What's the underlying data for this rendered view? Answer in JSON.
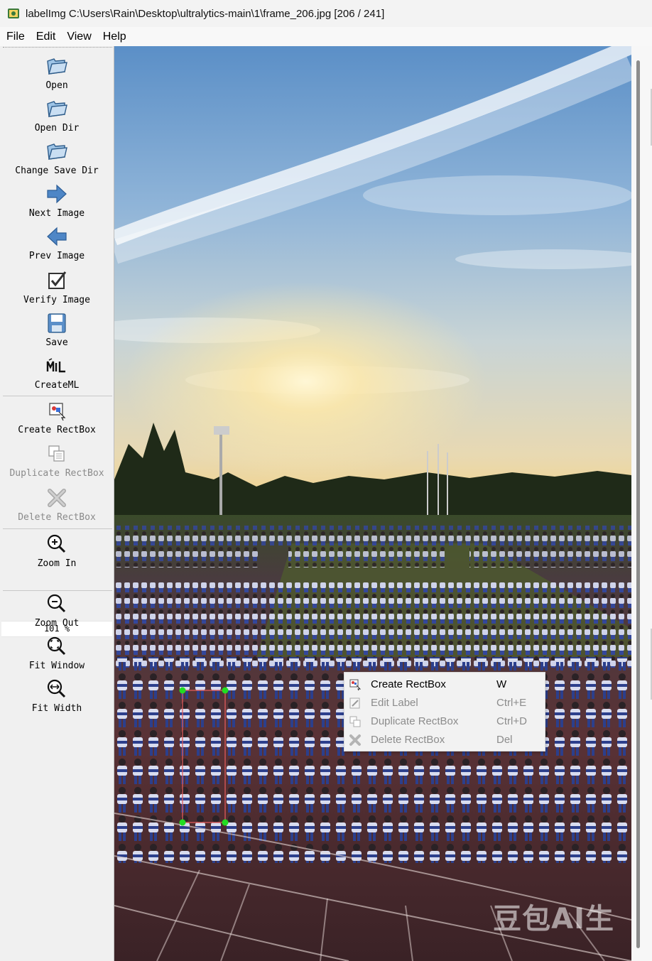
{
  "window": {
    "title": "labelImg C:\\Users\\Rain\\Desktop\\ultralytics-main\\1\\frame_206.jpg [206 / 241]",
    "app_icon": "labelimg-app-icon"
  },
  "menubar": {
    "items": [
      {
        "label": "File"
      },
      {
        "label": "Edit"
      },
      {
        "label": "View"
      },
      {
        "label": "Help"
      }
    ]
  },
  "toolbar": {
    "tools": [
      {
        "label": "Open",
        "icon": "folder-open-icon",
        "enabled": true
      },
      {
        "label": "Open Dir",
        "icon": "folder-open-icon",
        "enabled": true
      },
      {
        "label": "Change Save Dir",
        "icon": "folder-open-icon",
        "enabled": true
      },
      {
        "label": "Next Image",
        "icon": "arrow-right-icon",
        "enabled": true
      },
      {
        "label": "Prev Image",
        "icon": "arrow-left-icon",
        "enabled": true
      },
      {
        "label": "Verify Image",
        "icon": "checkbox-icon",
        "enabled": true
      },
      {
        "label": "Save",
        "icon": "floppy-disk-icon",
        "enabled": true
      },
      {
        "label": "CreateML",
        "icon": "createml-icon",
        "enabled": true
      },
      {
        "label": "Create RectBox",
        "icon": "create-rectbox-icon",
        "enabled": true
      },
      {
        "label": "Duplicate RectBox",
        "icon": "duplicate-rectbox-icon",
        "enabled": false
      },
      {
        "label": "Delete RectBox",
        "icon": "delete-x-icon",
        "enabled": false
      },
      {
        "label": "Zoom In",
        "icon": "zoom-in-icon",
        "enabled": true
      },
      {
        "label": "Zoom Out",
        "icon": "zoom-out-icon",
        "enabled": true
      },
      {
        "label": "Fit Window",
        "icon": "fit-window-icon",
        "enabled": true
      },
      {
        "label": "Fit Width",
        "icon": "fit-width-icon",
        "enabled": true
      }
    ],
    "zoom_value": "101 %"
  },
  "canvas": {
    "watermark": "豆包AI生",
    "bounding_box": {
      "line_color": "#e05a5a",
      "handle_color": "#22dd22"
    }
  },
  "context_menu": {
    "items": [
      {
        "label": "Create RectBox",
        "shortcut": "W",
        "icon": "create-rectbox-icon",
        "enabled": true
      },
      {
        "label": "Edit Label",
        "shortcut": "Ctrl+E",
        "icon": "edit-label-icon",
        "enabled": false
      },
      {
        "label": "Duplicate RectBox",
        "shortcut": "Ctrl+D",
        "icon": "duplicate-rectbox-icon",
        "enabled": false
      },
      {
        "label": "Delete RectBox",
        "shortcut": "Del",
        "icon": "delete-x-icon",
        "enabled": false
      }
    ]
  }
}
